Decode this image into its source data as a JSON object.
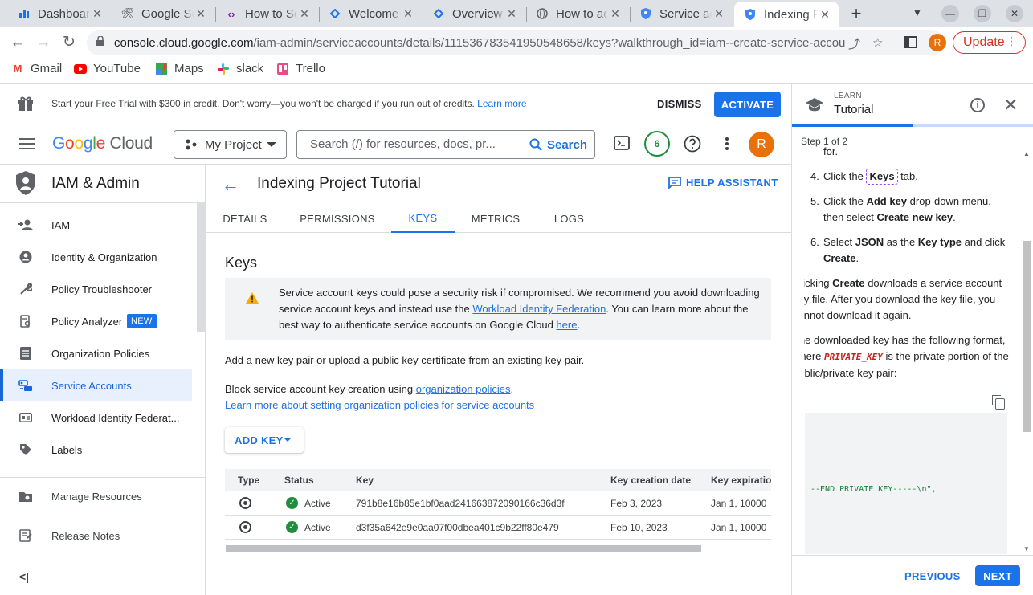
{
  "browser": {
    "tabs": [
      {
        "title": "Dashboard",
        "icon": "dashboard-icon"
      },
      {
        "title": "Google Search Console",
        "icon": "tools-icon"
      },
      {
        "title": "How to Set up",
        "icon": "code-icon"
      },
      {
        "title": "Welcome",
        "icon": "cloud-icon"
      },
      {
        "title": "Overview",
        "icon": "cloud-icon"
      },
      {
        "title": "How to add",
        "icon": "globe-icon"
      },
      {
        "title": "Service accounts",
        "icon": "shield-icon"
      },
      {
        "title": "Indexing Project",
        "icon": "shield-icon",
        "active": true
      }
    ],
    "url_host": "console.cloud.google.com",
    "url_path": "/iam-admin/serviceaccounts/details/111536783541950548658/keys?walkthrough_id=iam--create-service-account-...",
    "profile_initial": "R",
    "update_label": "Update",
    "bookmarks": [
      {
        "label": "Gmail"
      },
      {
        "label": "YouTube"
      },
      {
        "label": "Maps"
      },
      {
        "label": "slack"
      },
      {
        "label": "Trello"
      }
    ]
  },
  "trial_banner": {
    "text": "Start your Free Trial with $300 in credit. Don't worry—you won't be charged if you run out of credits.",
    "learn_more": "Learn more",
    "dismiss": "DISMISS",
    "activate": "ACTIVATE"
  },
  "header": {
    "logo_google": "Google",
    "logo_cloud": "Cloud",
    "project": "My Project",
    "search_placeholder": "Search (/) for resources, docs, pr...",
    "search_button": "Search",
    "notifications": "6",
    "avatar": "R"
  },
  "sidebar": {
    "title": "IAM & Admin",
    "items": [
      {
        "label": "IAM",
        "icon": "person-add-icon"
      },
      {
        "label": "Identity & Organization",
        "icon": "account-circle-icon"
      },
      {
        "label": "Policy Troubleshooter",
        "icon": "wrench-icon"
      },
      {
        "label": "Policy Analyzer",
        "icon": "policy-doc-icon",
        "badge": "NEW"
      },
      {
        "label": "Organization Policies",
        "icon": "list-doc-icon"
      },
      {
        "label": "Service Accounts",
        "icon": "service-account-icon",
        "selected": true
      },
      {
        "label": "Workload Identity Federat...",
        "icon": "id-card-icon"
      },
      {
        "label": "Labels",
        "icon": "tag-icon"
      }
    ],
    "footer": [
      {
        "label": "Manage Resources",
        "icon": "folder-gear-icon"
      },
      {
        "label": "Release Notes",
        "icon": "notes-icon"
      }
    ]
  },
  "main": {
    "title": "Indexing Project Tutorial",
    "help_assistant": "HELP ASSISTANT",
    "tabs": [
      "DETAILS",
      "PERMISSIONS",
      "KEYS",
      "METRICS",
      "LOGS"
    ],
    "active_tab": "KEYS",
    "section_title": "Keys",
    "warning_pre": "Service account keys could pose a security risk if compromised. We recommend you avoid downloading service account keys and instead use the ",
    "warning_link1": "Workload Identity Federation",
    "warning_mid": ". You can learn more about the best way to authenticate service accounts on Google Cloud ",
    "warning_link2": "here",
    "warning_post": ".",
    "add_pair_text": "Add a new key pair or upload a public key certificate from an existing key pair.",
    "block_text": "Block service account key creation using ",
    "block_link": "organization policies",
    "block_post": ".",
    "learn_link": "Learn more about setting organization policies for service accounts",
    "add_key": "ADD KEY",
    "table": {
      "columns": [
        "Type",
        "Status",
        "Key",
        "Key creation date",
        "Key expiration"
      ],
      "rows": [
        {
          "status": "Active",
          "key": "791b8e16b85e1bf0aad241663872090166c36d3f",
          "created": "Feb 3, 2023",
          "expires": "Jan 1, 10000"
        },
        {
          "status": "Active",
          "key": "d3f35a642e9e0aa07f00dbea401c9b22ff80e479",
          "created": "Feb 10, 2023",
          "expires": "Jan 1, 10000"
        }
      ]
    }
  },
  "tutorial": {
    "learn": "LEARN",
    "title": "Tutorial",
    "step": "Step 1 of 2",
    "progress_fraction": 0.5,
    "cut_top": "for.",
    "steps": [
      {
        "num": "4.",
        "pre": "Click the ",
        "chip": "Keys",
        "post": " tab."
      },
      {
        "num": "5.",
        "pre": "Click the ",
        "b1": "Add key",
        "mid": " drop-down menu, then select ",
        "b2": "Create new key",
        "post": "."
      },
      {
        "num": "6.",
        "pre": "Select ",
        "b1": "JSON",
        "mid": " as the ",
        "b2": "Key type",
        "mid2": " and click ",
        "b3": "Create",
        "post": "."
      }
    ],
    "para1_pre": "Clicking ",
    "para1_b": "Create",
    "para1_post": " downloads a service account key file. After you download the key file, you cannot download it again.",
    "para2_pre": "The downloaded key has the following format, where ",
    "para2_code": "PRIVATE_KEY",
    "para2_post": " is the private portion of the public/private key pair:",
    "code_line": "--END PRIVATE KEY-----\\n\",",
    "previous": "PREVIOUS",
    "next": "NEXT"
  }
}
